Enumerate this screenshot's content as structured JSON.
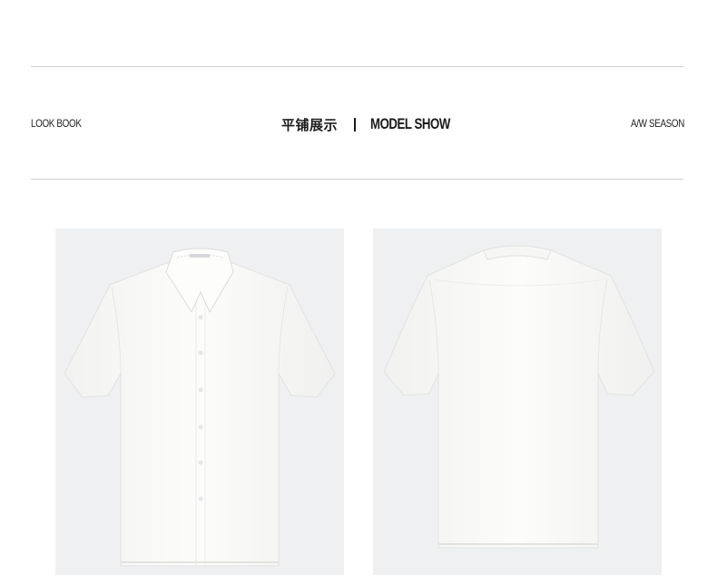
{
  "header": {
    "left_label": "LOOK BOOK",
    "title_cn": "平铺展示",
    "title_en": "MODEL SHOW",
    "right_label": "A/W SEASON"
  },
  "gallery": {
    "images": [
      {
        "view": "front",
        "alt": "short-sleeve white shirt front view"
      },
      {
        "view": "back",
        "alt": "short-sleeve white shirt back view"
      }
    ]
  },
  "colors": {
    "rule": "#cfcfcf",
    "photo_bg": "#eef0f2",
    "shirt": "#fbfbfa"
  }
}
